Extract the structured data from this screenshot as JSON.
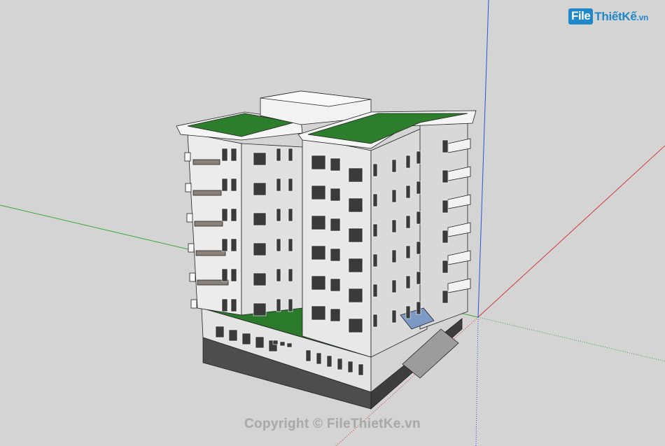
{
  "watermark": {
    "logo_box": "File",
    "logo_text": "ThiếtKế",
    "logo_suffix": ".vn",
    "copyright": "Copyright © FileThietKe.vn"
  },
  "colors": {
    "background": "#d4d4d4",
    "axis_green": "#3aa83a",
    "axis_red": "#d23a3a",
    "axis_blue": "#2a55d0",
    "wall": "#e9e9e9",
    "roof_garden": "#1f6b1f",
    "base": "#4a4a4a",
    "logo": "#1e88c8"
  }
}
